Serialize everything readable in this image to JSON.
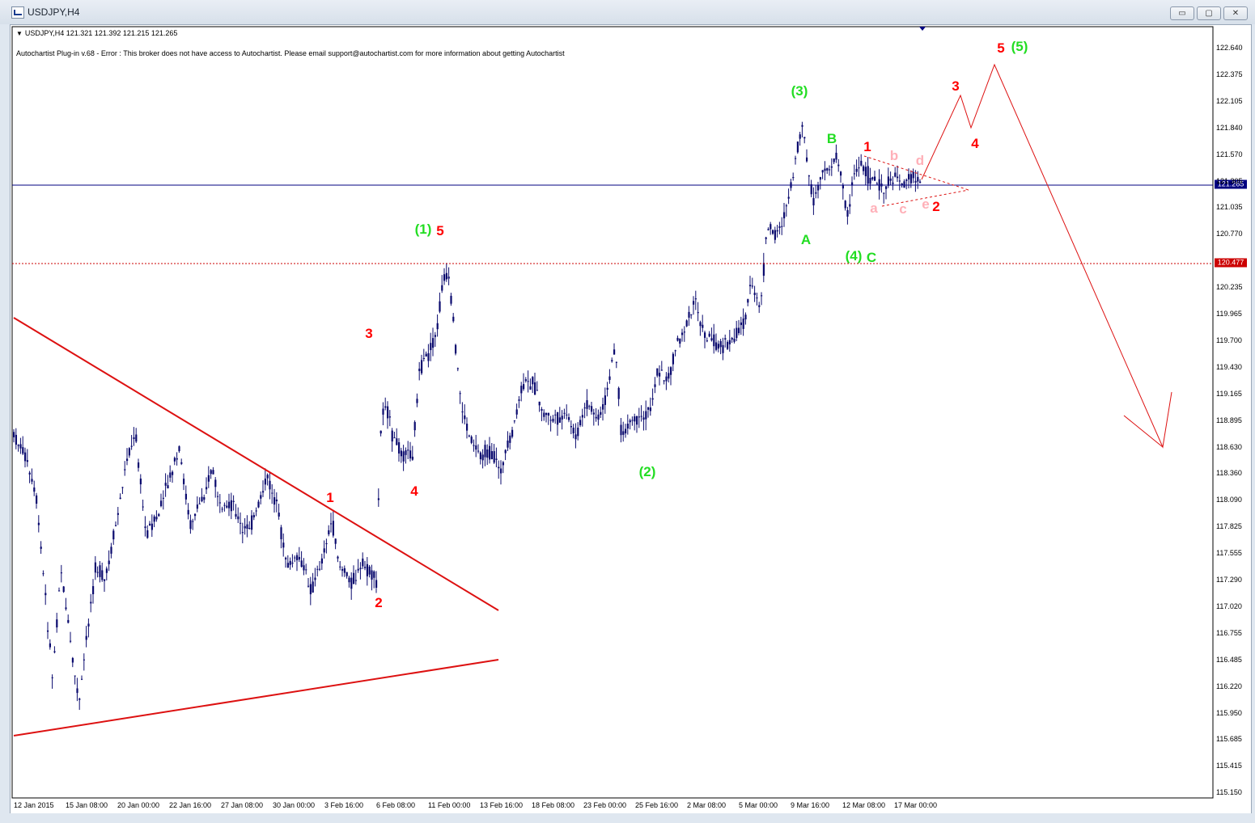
{
  "window": {
    "title": "USDJPY,H4",
    "minimize_label": "▭",
    "maximize_label": "▢",
    "close_label": "✕"
  },
  "chart": {
    "symbol_line": "USDJPY,H4  121.321 121.392 121.215 121.265",
    "plugin_message": "Autochartist Plug-in v.68 - Error : This broker does not have access to Autochartist. Please email support@autochartist.com for more information about getting Autochartist",
    "current_price_label": "121.265",
    "level_price_label": "120.477",
    "colors": {
      "bars": "#0a0a6e",
      "wave_red": "#ff0000",
      "wave_green": "#22dd22",
      "sub_wave_pink": "#ffb0b8",
      "current_price_line": "#000080",
      "level_line": "#cc0000",
      "trendline": "#dd1111"
    }
  },
  "y_ticks": [
    "122.640",
    "122.375",
    "122.105",
    "121.840",
    "121.570",
    "121.305",
    "121.035",
    "120.770",
    "120.477",
    "120.235",
    "119.965",
    "119.700",
    "119.430",
    "119.165",
    "118.895",
    "118.630",
    "118.360",
    "118.090",
    "117.825",
    "117.555",
    "117.290",
    "117.020",
    "116.755",
    "116.485",
    "116.220",
    "115.950",
    "115.685",
    "115.415",
    "115.150"
  ],
  "x_ticks": [
    "12 Jan 2015",
    "15 Jan 08:00",
    "20 Jan 00:00",
    "22 Jan 16:00",
    "27 Jan 08:00",
    "30 Jan 00:00",
    "3 Feb 16:00",
    "6 Feb 08:00",
    "11 Feb 00:00",
    "13 Feb 16:00",
    "18 Feb 08:00",
    "23 Feb 00:00",
    "25 Feb 16:00",
    "2 Mar 08:00",
    "5 Mar 00:00",
    "9 Mar 16:00",
    "12 Mar 08:00",
    "17 Mar 00:00"
  ],
  "wave_labels": {
    "left_1": "1",
    "left_2": "2",
    "left_3": "3",
    "left_4": "4",
    "left_5": "5",
    "g_1": "(1)",
    "g_2": "(2)",
    "g_3": "(3)",
    "g_4": "(4)",
    "g_5": "(5)",
    "g_A": "A",
    "g_B": "B",
    "g_C": "C",
    "right_1": "1",
    "right_2": "2",
    "right_3": "3",
    "right_4": "4",
    "right_5": "5",
    "sub_a": "a",
    "sub_b": "b",
    "sub_c": "c",
    "sub_d": "d",
    "sub_e": "e"
  }
}
